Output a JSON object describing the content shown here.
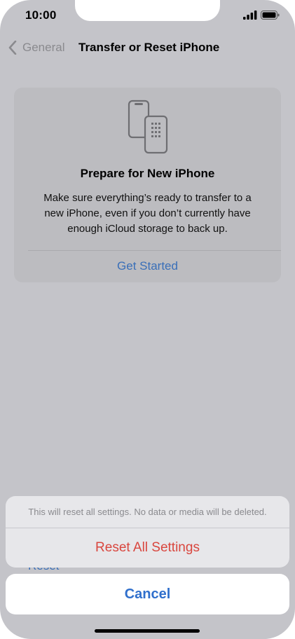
{
  "status_bar": {
    "time": "10:00",
    "icons": [
      "cellular-signal-icon",
      "battery-icon"
    ]
  },
  "nav": {
    "back_label": "General",
    "back_icon": "chevron-left-icon",
    "title": "Transfer or Reset iPhone"
  },
  "card": {
    "icon": "phone-transfer-icon",
    "title": "Prepare for New iPhone",
    "body": "Make sure everything’s ready to transfer to a new iPhone, even if you don’t currently have enough iCloud storage to back up.",
    "action_label": "Get Started"
  },
  "underlying_row": {
    "label": "Reset"
  },
  "action_sheet": {
    "message": "This will reset all settings. No data or media will be deleted.",
    "destructive_label": "Reset All Settings",
    "cancel_label": "Cancel"
  },
  "colors": {
    "dimmed_background": "#c4c4c9",
    "link_blue": "#3a6fb8",
    "destructive_red": "#d9463e",
    "cancel_blue": "#2f6fcc"
  }
}
